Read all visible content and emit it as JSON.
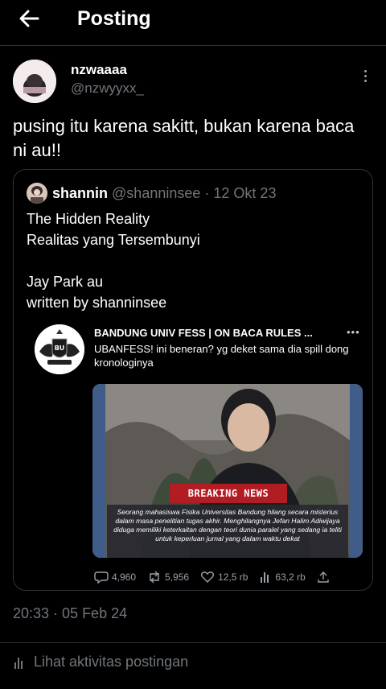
{
  "header": {
    "title": "Posting",
    "back_icon": "arrow-left-icon"
  },
  "post": {
    "display_name": "nzwaaaa",
    "handle": "@nzwyyxx_",
    "text": "pusing itu karena sakitt, bukan karena baca ni au!!",
    "timestamp": "20:33 · 05 Feb 24"
  },
  "quote": {
    "name": "shannin",
    "handle": "@shanninsee",
    "date": "· 12 Okt 23",
    "text": "The Hidden Reality\nRealitas yang Tersembunyi\n\nJay Park au\nwritten by shanninsee",
    "embedded": {
      "account": "BANDUNG UNIV FESS | ON BACA RULES ...",
      "logo_text": "BU",
      "text": "UBANFESS! ini beneran? yg deket sama dia spill dong kronologinya",
      "breaking": "BREAKING NEWS",
      "caption": "Seorang mahasiswa Fisika Universitas Bandung hilang secara misterius dalam masa penelitian tugas akhir. Menghilangnya Jefan Halim Adiwijaya diduga memiliki keterkaitan dengan teori dunia paralel yang sedang ia teliti untuk keperluan jurnal yang dalam waktu dekat",
      "stats": {
        "replies": "4,960",
        "reposts": "5,956",
        "likes": "12,5 rb",
        "views": "63,2 rb"
      }
    }
  },
  "footer": {
    "activity_label": "Lihat aktivitas postingan"
  }
}
